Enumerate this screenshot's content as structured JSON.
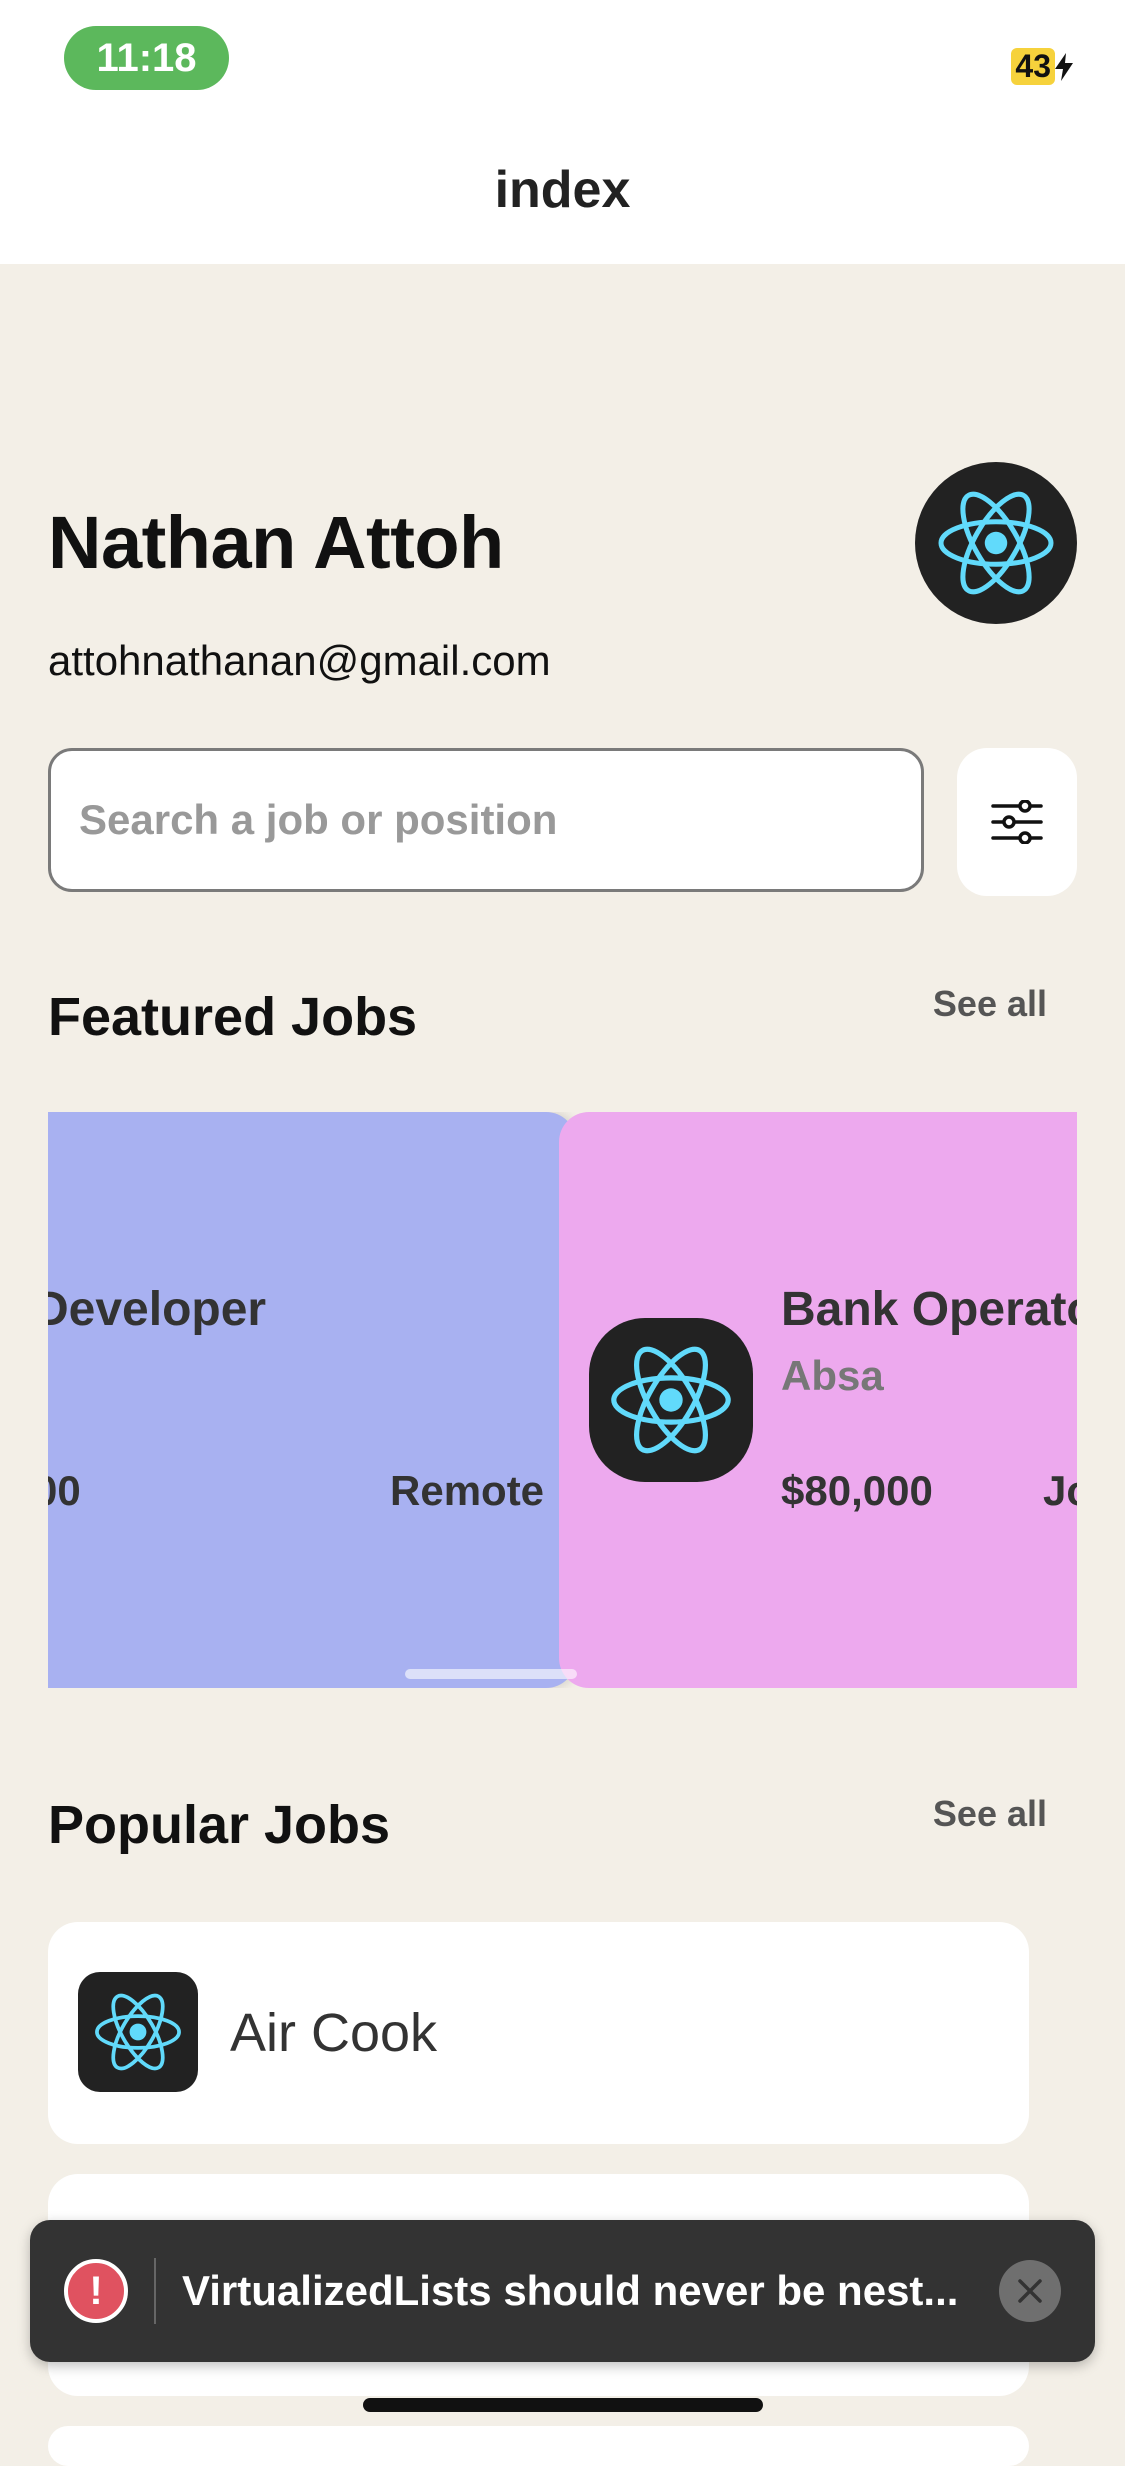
{
  "status_bar": {
    "time": "11:18",
    "battery_level": "43",
    "charging_icon": "bolt-icon"
  },
  "header": {
    "title": "index"
  },
  "profile": {
    "name": "Nathan Attoh",
    "email": "attohnathanan@gmail.com",
    "avatar_icon": "react-logo-icon"
  },
  "search": {
    "placeholder": "Search a job or position",
    "value": "",
    "filter_icon": "sliders-icon"
  },
  "featured": {
    "title": "Featured Jobs",
    "see_all": "See all",
    "cards": [
      {
        "title": "Developer",
        "salary": "00",
        "location": "Remote",
        "color": "#a8b1f1"
      },
      {
        "title": "Bank Operato",
        "company": "Absa",
        "salary": "$80,000",
        "location": "Joha",
        "color": "#eda9ee"
      }
    ]
  },
  "popular": {
    "title": "Popular Jobs",
    "see_all": "See all",
    "items": [
      {
        "title": "Air Cook"
      }
    ]
  },
  "toast": {
    "message": "VirtualizedLists should never be nest...",
    "icon": "error-icon"
  },
  "colors": {
    "background": "#f3efe7",
    "time_pill": "#5cb85c",
    "toast": "#333333",
    "error": "#e05260"
  }
}
